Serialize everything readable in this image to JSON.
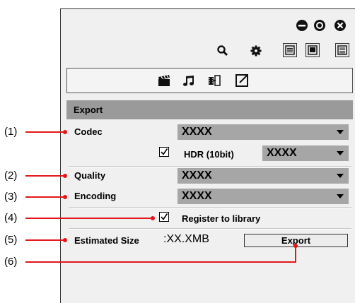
{
  "window": {
    "controls": [
      "minimize-icon",
      "maximize-icon",
      "close-icon"
    ]
  },
  "toolbar": {
    "icons": [
      "search-icon",
      "gear-icon",
      "list-view-icon",
      "thumbnail-view-icon",
      "detail-view-icon"
    ]
  },
  "tabs": [
    {
      "icon": "clapperboard-icon"
    },
    {
      "icon": "music-note-icon"
    },
    {
      "icon": "film-transition-icon"
    },
    {
      "icon": "export-icon",
      "selected": true
    }
  ],
  "export_panel": {
    "header": "Export",
    "codec": {
      "label": "Codec",
      "value": "XXXX"
    },
    "hdr": {
      "label": "HDR (10bit)",
      "checked": true,
      "value": "XXXX"
    },
    "quality": {
      "label": "Quality",
      "value": "XXXX"
    },
    "encoding": {
      "label": "Encoding",
      "value": "XXXX"
    },
    "register": {
      "label": "Register to library",
      "checked": true
    },
    "estimated_size": {
      "label": "Estimated Size",
      "value": ":XX.XMB"
    },
    "export_button": "Export"
  },
  "callouts": [
    "(1)",
    "(2)",
    "(3)",
    "(4)",
    "(5)",
    "(6)"
  ],
  "colors": {
    "callout_line": "#e4161b",
    "header_bg": "#9a9a9a",
    "select_bg": "#a6a6a6"
  }
}
